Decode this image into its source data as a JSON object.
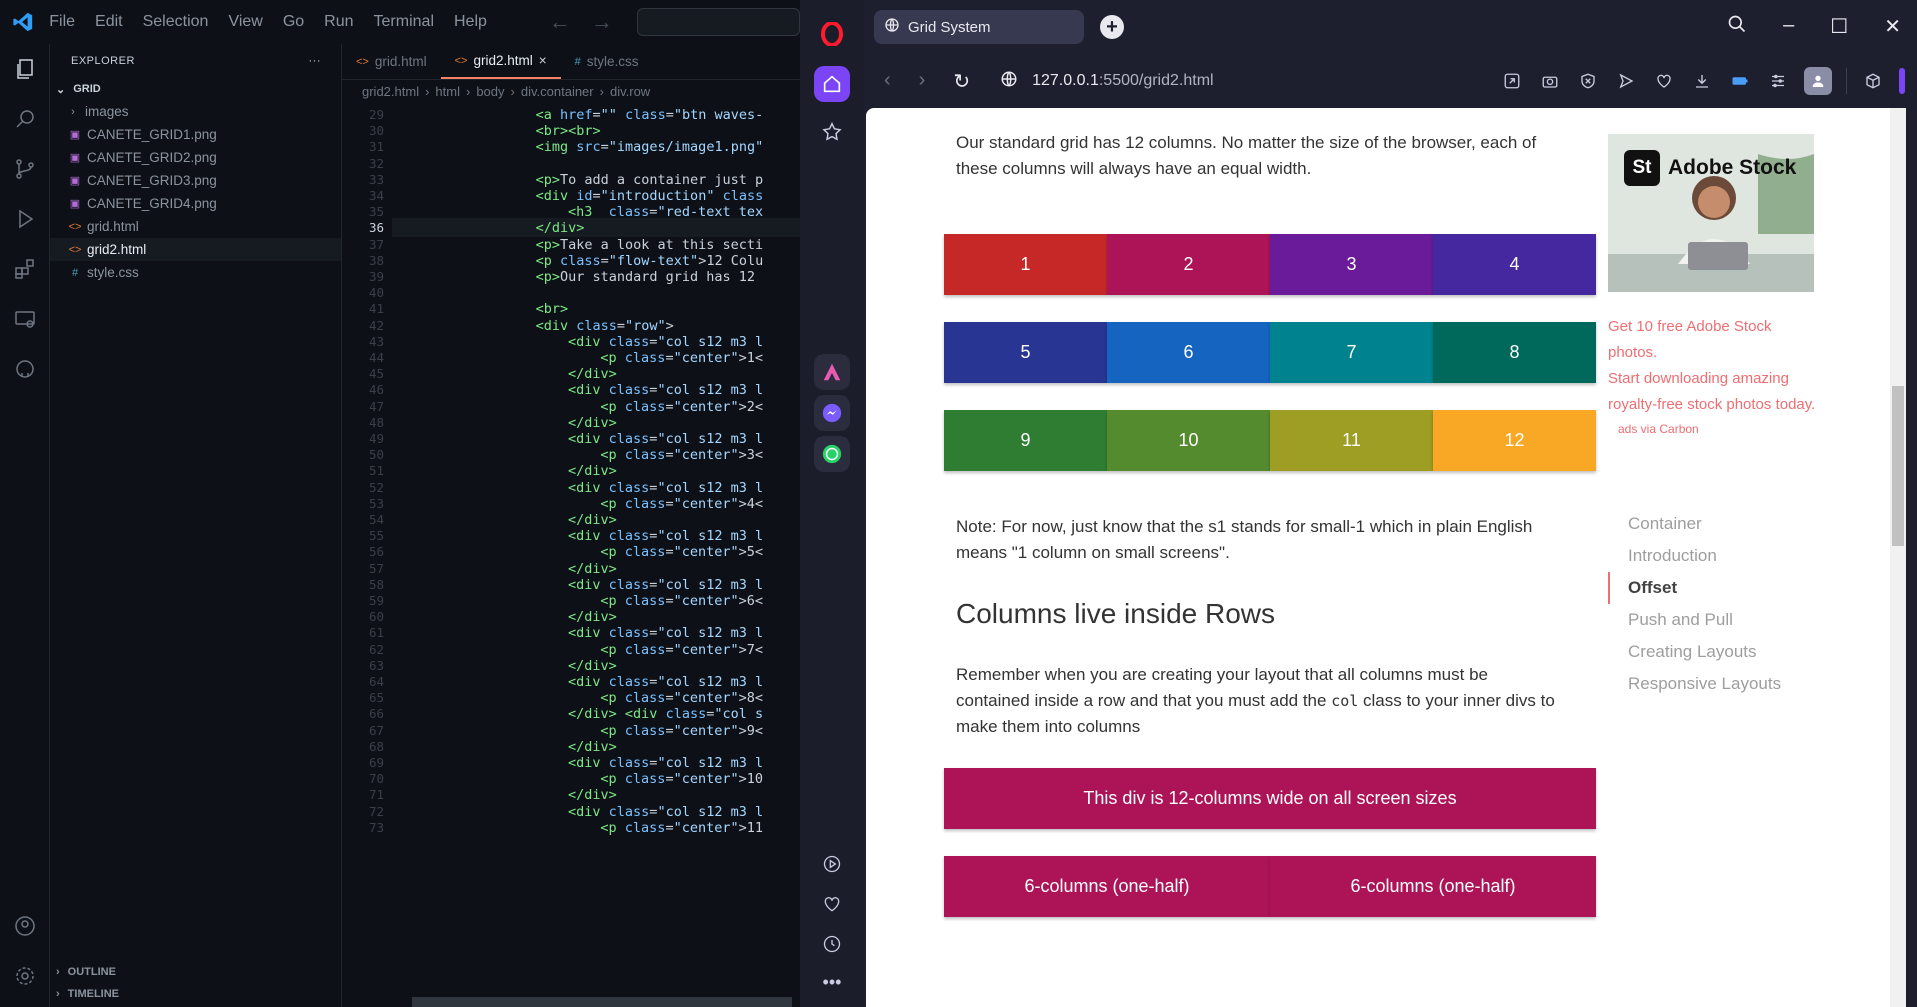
{
  "vscode": {
    "menu": [
      "File",
      "Edit",
      "Selection",
      "View",
      "Go",
      "Run",
      "Terminal",
      "Help"
    ],
    "explorer_title": "EXPLORER",
    "folder": "GRID",
    "files": [
      {
        "name": "images",
        "type": "folder"
      },
      {
        "name": "CANETE_GRID1.png",
        "type": "png"
      },
      {
        "name": "CANETE_GRID2.png",
        "type": "png"
      },
      {
        "name": "CANETE_GRID3.png",
        "type": "png"
      },
      {
        "name": "CANETE_GRID4.png",
        "type": "png"
      },
      {
        "name": "grid.html",
        "type": "html"
      },
      {
        "name": "grid2.html",
        "type": "html",
        "active": true
      },
      {
        "name": "style.css",
        "type": "css"
      }
    ],
    "outline": "OUTLINE",
    "timeline": "TIMELINE",
    "tabs": [
      {
        "label": "grid.html",
        "icon": "<>"
      },
      {
        "label": "grid2.html",
        "icon": "<>",
        "active": true,
        "close": "×"
      },
      {
        "label": "style.css",
        "icon": "#"
      }
    ],
    "breadcrumbs": [
      "grid2.html",
      "html",
      "body",
      "div.container",
      "div.row"
    ],
    "current_line": 36,
    "code_lines": [
      {
        "n": 29,
        "indent": 16,
        "html": "<span class='t'>&lt;a</span> <span class='a'>href</span>=<span class='s'>\"\"</span> <span class='a'>class</span>=<span class='s'>\"btn waves-</span>"
      },
      {
        "n": 30,
        "indent": 16,
        "html": "<span class='t'>&lt;br&gt;&lt;br&gt;</span>"
      },
      {
        "n": 31,
        "indent": 16,
        "html": "<span class='t'>&lt;img</span> <span class='a'>src</span>=<span class='s'>\"images/image1.png\"</span>"
      },
      {
        "n": 32,
        "indent": 0,
        "html": ""
      },
      {
        "n": 33,
        "indent": 16,
        "html": "<span class='t'>&lt;p&gt;</span>To add a container just p"
      },
      {
        "n": 34,
        "indent": 16,
        "html": "<span class='t'>&lt;div</span> <span class='a'>id</span>=<span class='s'>\"introduction\"</span> <span class='a'>class</span>"
      },
      {
        "n": 35,
        "indent": 20,
        "html": "<span class='t'>&lt;h3</span>  <span class='a'>class</span>=<span class='s'>\"red-text tex</span>"
      },
      {
        "n": 36,
        "indent": 16,
        "html": "<span class='t'>&lt;/div&gt;</span>"
      },
      {
        "n": 37,
        "indent": 16,
        "html": "<span class='t'>&lt;p&gt;</span>Take a look at this secti"
      },
      {
        "n": 38,
        "indent": 16,
        "html": "<span class='t'>&lt;p</span> <span class='a'>class</span>=<span class='s'>\"flow-text\"</span>&gt;12 Colu"
      },
      {
        "n": 39,
        "indent": 16,
        "html": "<span class='t'>&lt;p&gt;</span>Our standard grid has 12"
      },
      {
        "n": 40,
        "indent": 0,
        "html": ""
      },
      {
        "n": 41,
        "indent": 16,
        "html": "<span class='t'>&lt;br&gt;</span>"
      },
      {
        "n": 42,
        "indent": 16,
        "html": "<span class='t'>&lt;div</span> <span class='a'>class</span>=<span class='s'>\"row\"</span>&gt;"
      },
      {
        "n": 43,
        "indent": 20,
        "html": "<span class='t'>&lt;div</span> <span class='a'>class</span>=<span class='s'>\"col s12 m3 l</span>"
      },
      {
        "n": 44,
        "indent": 24,
        "html": "<span class='t'>&lt;p</span> <span class='a'>class</span>=<span class='s'>\"center\"</span>&gt;1&lt;"
      },
      {
        "n": 45,
        "indent": 20,
        "html": "<span class='t'>&lt;/div&gt;</span>"
      },
      {
        "n": 46,
        "indent": 20,
        "html": "<span class='t'>&lt;div</span> <span class='a'>class</span>=<span class='s'>\"col s12 m3 l</span>"
      },
      {
        "n": 47,
        "indent": 24,
        "html": "<span class='t'>&lt;p</span> <span class='a'>class</span>=<span class='s'>\"center\"</span>&gt;2&lt;"
      },
      {
        "n": 48,
        "indent": 20,
        "html": "<span class='t'>&lt;/div&gt;</span>"
      },
      {
        "n": 49,
        "indent": 20,
        "html": "<span class='t'>&lt;div</span> <span class='a'>class</span>=<span class='s'>\"col s12 m3 l</span>"
      },
      {
        "n": 50,
        "indent": 24,
        "html": "<span class='t'>&lt;p</span> <span class='a'>class</span>=<span class='s'>\"center\"</span>&gt;3&lt;"
      },
      {
        "n": 51,
        "indent": 20,
        "html": "<span class='t'>&lt;/div&gt;</span>"
      },
      {
        "n": 52,
        "indent": 20,
        "html": "<span class='t'>&lt;div</span> <span class='a'>class</span>=<span class='s'>\"col s12 m3 l</span>"
      },
      {
        "n": 53,
        "indent": 24,
        "html": "<span class='t'>&lt;p</span> <span class='a'>class</span>=<span class='s'>\"center\"</span>&gt;4&lt;"
      },
      {
        "n": 54,
        "indent": 20,
        "html": "<span class='t'>&lt;/div&gt;</span>"
      },
      {
        "n": 55,
        "indent": 20,
        "html": "<span class='t'>&lt;div</span> <span class='a'>class</span>=<span class='s'>\"col s12 m3 l</span>"
      },
      {
        "n": 56,
        "indent": 24,
        "html": "<span class='t'>&lt;p</span> <span class='a'>class</span>=<span class='s'>\"center\"</span>&gt;5&lt;"
      },
      {
        "n": 57,
        "indent": 20,
        "html": "<span class='t'>&lt;/div&gt;</span>"
      },
      {
        "n": 58,
        "indent": 20,
        "html": "<span class='t'>&lt;div</span> <span class='a'>class</span>=<span class='s'>\"col s12 m3 l</span>"
      },
      {
        "n": 59,
        "indent": 24,
        "html": "<span class='t'>&lt;p</span> <span class='a'>class</span>=<span class='s'>\"center\"</span>&gt;6&lt;"
      },
      {
        "n": 60,
        "indent": 20,
        "html": "<span class='t'>&lt;/div&gt;</span>"
      },
      {
        "n": 61,
        "indent": 20,
        "html": "<span class='t'>&lt;div</span> <span class='a'>class</span>=<span class='s'>\"col s12 m3 l</span>"
      },
      {
        "n": 62,
        "indent": 24,
        "html": "<span class='t'>&lt;p</span> <span class='a'>class</span>=<span class='s'>\"center\"</span>&gt;7&lt;"
      },
      {
        "n": 63,
        "indent": 20,
        "html": "<span class='t'>&lt;/div&gt;</span>"
      },
      {
        "n": 64,
        "indent": 20,
        "html": "<span class='t'>&lt;div</span> <span class='a'>class</span>=<span class='s'>\"col s12 m3 l</span>"
      },
      {
        "n": 65,
        "indent": 24,
        "html": "<span class='t'>&lt;p</span> <span class='a'>class</span>=<span class='s'>\"center\"</span>&gt;8&lt;"
      },
      {
        "n": 66,
        "indent": 20,
        "html": "<span class='t'>&lt;/div&gt;</span> <span class='t'>&lt;div</span> <span class='a'>class</span>=<span class='s'>\"col s</span>"
      },
      {
        "n": 67,
        "indent": 24,
        "html": "<span class='t'>&lt;p</span> <span class='a'>class</span>=<span class='s'>\"center\"</span>&gt;9&lt;"
      },
      {
        "n": 68,
        "indent": 20,
        "html": "<span class='t'>&lt;/div&gt;</span>"
      },
      {
        "n": 69,
        "indent": 20,
        "html": "<span class='t'>&lt;div</span> <span class='a'>class</span>=<span class='s'>\"col s12 m3 l</span>"
      },
      {
        "n": 70,
        "indent": 24,
        "html": "<span class='t'>&lt;p</span> <span class='a'>class</span>=<span class='s'>\"center\"</span>&gt;10"
      },
      {
        "n": 71,
        "indent": 20,
        "html": "<span class='t'>&lt;/div&gt;</span>"
      },
      {
        "n": 72,
        "indent": 20,
        "html": "<span class='t'>&lt;div</span> <span class='a'>class</span>=<span class='s'>\"col s12 m3 l</span>"
      },
      {
        "n": 73,
        "indent": 24,
        "html": "<span class='t'>&lt;p</span> <span class='a'>class</span>=<span class='s'>\"center\"</span>&gt;11"
      }
    ]
  },
  "browser": {
    "tab_title": "Grid System",
    "url_host": "127.0.0.1",
    "url_path": ":5500/grid2.html",
    "page": {
      "intro": "Our standard grid has 12 columns. No matter the size of the browser, each of these columns will always have an equal width.",
      "grid_rows": [
        [
          {
            "label": "1",
            "color": "#c62828"
          },
          {
            "label": "2",
            "color": "#ad1457"
          },
          {
            "label": "3",
            "color": "#6a1b9a"
          },
          {
            "label": "4",
            "color": "#4527a0"
          }
        ],
        [
          {
            "label": "5",
            "color": "#283593"
          },
          {
            "label": "6",
            "color": "#1565c0"
          },
          {
            "label": "7",
            "color": "#00838f"
          },
          {
            "label": "8",
            "color": "#00695c"
          }
        ],
        [
          {
            "label": "9",
            "color": "#2e7d32"
          },
          {
            "label": "10",
            "color": "#558b2f"
          },
          {
            "label": "11",
            "color": "#9e9d24"
          },
          {
            "label": "12",
            "color": "#f9a825"
          }
        ]
      ],
      "note": "Note: For now, just know that the s1 stands for small-1 which in plain English means \"1 column on small screens\".",
      "heading": "Columns live inside Rows",
      "para_before": "Remember when you are creating your layout that all columns must be contained inside a row and that you must add the ",
      "para_code": "col",
      "para_after": " class to your inner divs to make them into columns",
      "full_bar": "This div is 12-columns wide on all screen sizes",
      "half_bars": [
        "6-columns (one-half)",
        "6-columns (one-half)"
      ],
      "bar_color": "#ad1457",
      "ad": {
        "brand": "Adobe Stock",
        "brand_badge": "St",
        "line1": "Get 10 free Adobe Stock photos.",
        "line2": "Start downloading amazing royalty-free stock photos today.",
        "via": "ads via Carbon"
      },
      "toc": [
        {
          "label": "Container",
          "active": false
        },
        {
          "label": "Introduction",
          "active": false
        },
        {
          "label": "Offset",
          "active": true
        },
        {
          "label": "Push and Pull",
          "active": false
        },
        {
          "label": "Creating Layouts",
          "active": false
        },
        {
          "label": "Responsive Layouts",
          "active": false
        }
      ]
    }
  }
}
